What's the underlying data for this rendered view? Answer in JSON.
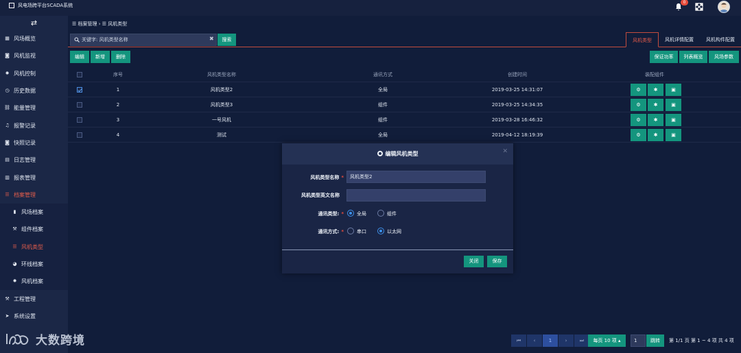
{
  "app": {
    "title": "风电场跨平台SCADA系统",
    "notification_count": "0"
  },
  "sidebar": {
    "items": [
      {
        "label": "风场概览",
        "icon": "grid-icon"
      },
      {
        "label": "风机监视",
        "icon": "camera-icon"
      },
      {
        "label": "风机控制",
        "icon": "gear-icon"
      },
      {
        "label": "历史数据",
        "icon": "clock-icon"
      },
      {
        "label": "能量管理",
        "icon": "link-icon"
      },
      {
        "label": "报警记录",
        "icon": "bell-icon"
      },
      {
        "label": "快照记录",
        "icon": "camera-icon"
      },
      {
        "label": "日志管理",
        "icon": "file-icon"
      },
      {
        "label": "报表管理",
        "icon": "table-icon"
      },
      {
        "label": "档案管理",
        "icon": "list-icon"
      }
    ],
    "sub_items": [
      {
        "label": "风场档案",
        "icon": "bookmark-icon"
      },
      {
        "label": "组件档案",
        "icon": "wrench-icon"
      },
      {
        "label": "风机类型",
        "icon": "list-icon"
      },
      {
        "label": "环线档案",
        "icon": "pie-icon"
      },
      {
        "label": "风机档案",
        "icon": "gear-icon"
      }
    ],
    "bottom_items": [
      {
        "label": "工程管理",
        "icon": "wrench-icon"
      },
      {
        "label": "系统设置",
        "icon": "send-icon"
      }
    ]
  },
  "breadcrumb": {
    "level1": "档案管理",
    "level2": "风机类型"
  },
  "search": {
    "placeholder": "关键字: 风机类型名称",
    "button": "搜索"
  },
  "tabs": [
    "风机类型",
    "风机详情配置",
    "风机构件配置"
  ],
  "actions": {
    "edit": "编辑",
    "add": "新增",
    "delete": "删除",
    "right": [
      "保证功率",
      "列表概览",
      "风场参数"
    ]
  },
  "table": {
    "headers": [
      "序号",
      "风机类型名称",
      "通讯方式",
      "创建时间",
      "装配组件"
    ],
    "rows": [
      {
        "index": "1",
        "name": "风机类型2",
        "comm": "全局",
        "created": "2019-03-25 14:31:07",
        "checked": true
      },
      {
        "index": "2",
        "name": "风机类型3",
        "comm": "组件",
        "created": "2019-03-25 14:34:35",
        "checked": false
      },
      {
        "index": "3",
        "name": "一号风机",
        "comm": "组件",
        "created": "2019-03-28 16:46:32",
        "checked": false
      },
      {
        "index": "4",
        "name": "测试",
        "comm": "全局",
        "created": "2019-04-12 18:19:39",
        "checked": false
      }
    ]
  },
  "modal": {
    "title": "编辑风机类型",
    "name_label": "风机类型名称",
    "name_value": "风机类型2",
    "en_name_label": "风机类型英文名称",
    "en_name_value": "",
    "comm_type_label": "通讯类型:",
    "comm_type_options": [
      "全局",
      "组件"
    ],
    "comm_type_selected": "全局",
    "comm_mode_label": "通讯方式:",
    "comm_mode_options": [
      "串口",
      "以太网"
    ],
    "comm_mode_selected": "以太网",
    "close_button": "关闭",
    "save_button": "保存"
  },
  "pagination": {
    "current_page": "1",
    "page_size_label": "每页 10 项",
    "jump_input": "1",
    "jump_button": "跳转",
    "page_info": "第 1/1 页",
    "range_info": "第 1 ~ 4 项",
    "total_info": "共 4 项"
  },
  "watermark": {
    "text": "大数跨境"
  },
  "colors": {
    "accent_teal": "#14957e",
    "active_red": "#e15c4b",
    "background": "#111d3a"
  }
}
